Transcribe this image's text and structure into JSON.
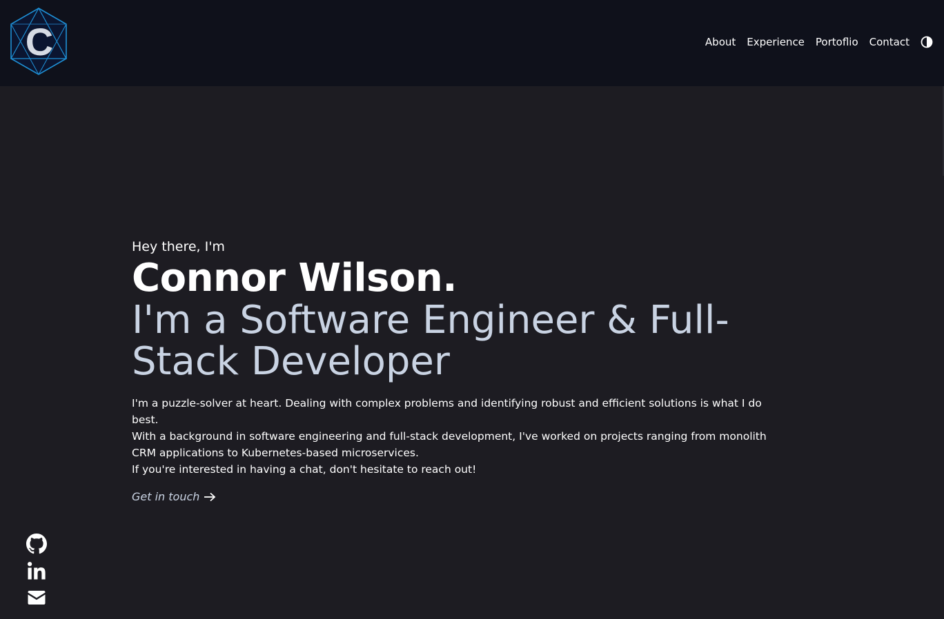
{
  "header": {
    "logo_letter": "C",
    "nav": [
      {
        "label": "About"
      },
      {
        "label": "Experience"
      },
      {
        "label": "Portoflio"
      },
      {
        "label": "Contact"
      }
    ],
    "theme_toggle_icon": "half-circle-contrast-icon"
  },
  "hero": {
    "greeting": "Hey there, I'm",
    "name": "Connor Wilson.",
    "role": "I'm a Software Engineer & Full-Stack Developer",
    "bio": [
      "I'm a puzzle-solver at heart. Dealing with complex problems and identifying robust and efficient solutions is what I do best.",
      "With a background in software engineering and full-stack development, I've worked on projects ranging from monolith CRM applications to Kubernetes-based microservices.",
      "If you're interested in having a chat, don't hesitate to reach out!"
    ],
    "cta": "Get in touch"
  },
  "socials": [
    {
      "icon": "github-icon"
    },
    {
      "icon": "linkedin-icon"
    },
    {
      "icon": "mail-icon"
    }
  ],
  "colors": {
    "page_bg": "#1d1c22",
    "header_bg": "#0f111b",
    "text": "#ffffff",
    "accent_text": "#c9d3e3",
    "logo_blue": "#1e90d6"
  }
}
